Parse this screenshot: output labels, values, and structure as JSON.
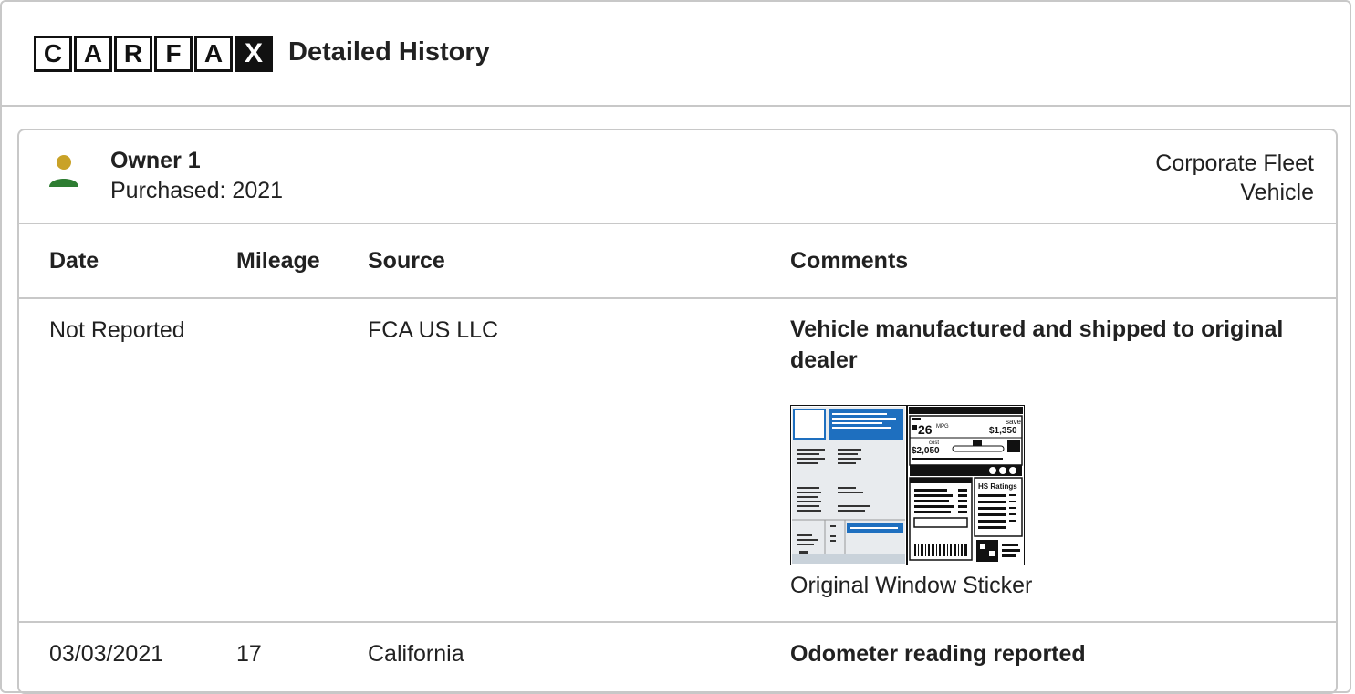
{
  "header": {
    "logo_letters": [
      "C",
      "A",
      "R",
      "F",
      "A",
      "X"
    ],
    "title": "Detailed History"
  },
  "owner": {
    "name": "Owner 1",
    "purchased": "Purchased: 2021",
    "type": "Corporate Fleet Vehicle"
  },
  "table": {
    "headers": {
      "date": "Date",
      "mileage": "Mileage",
      "source": "Source",
      "comments": "Comments"
    },
    "rows": [
      {
        "date": "Not Reported",
        "mileage": "",
        "source": "FCA US LLC",
        "comment": "Vehicle manufactured and shipped to original dealer",
        "attachment_label": "Original Window Sticker"
      },
      {
        "date": "03/03/2021",
        "mileage": "17",
        "source": "California",
        "comment": "Odometer reading reported"
      }
    ]
  },
  "sticker": {
    "mpg": "26",
    "mpg_unit": "MPG",
    "save_label": "save",
    "save_amount": "$1,350",
    "cost_label": "cost",
    "cost_amount": "$2,050",
    "ratings_label": "HS Ratings"
  },
  "colors": {
    "border": "#c8c8c8",
    "avatar_head": "#c9a227",
    "avatar_body": "#2e7d32",
    "sticker_blue": "#1e6fbf"
  }
}
